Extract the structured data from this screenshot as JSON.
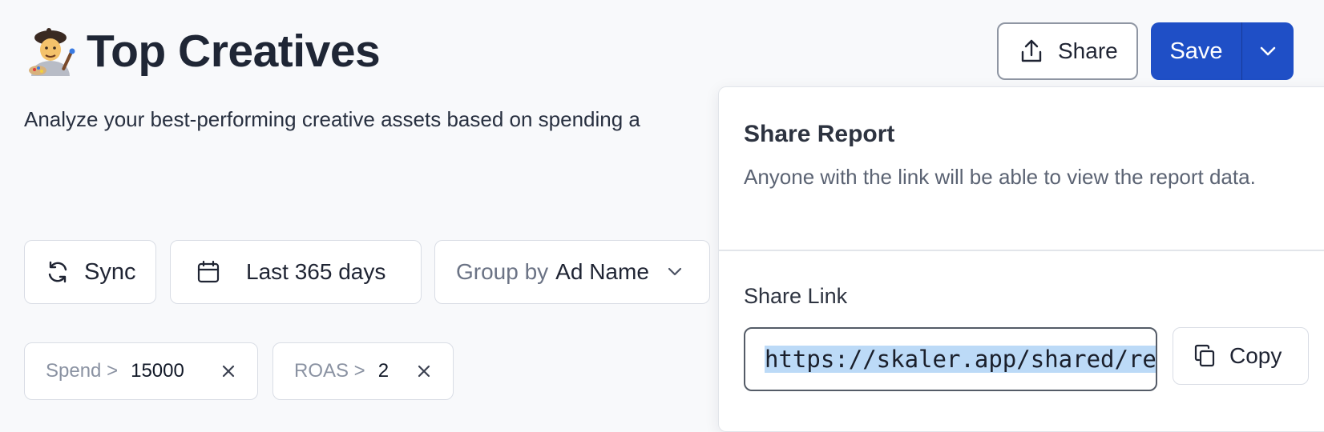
{
  "header": {
    "title": "Top Creatives",
    "emoji_icon": "artist-emoji",
    "subtitle": "Analyze your best-performing creative assets based on spending a"
  },
  "actions": {
    "share_label": "Share",
    "save_label": "Save"
  },
  "toolbar": {
    "sync_label": "Sync",
    "date_range": "Last 365 days",
    "group_prefix": "Group by",
    "group_value": "Ad Name"
  },
  "filters": [
    {
      "label": "Spend >",
      "value": "15000"
    },
    {
      "label": "ROAS >",
      "value": "2"
    }
  ],
  "share_popover": {
    "title": "Share Report",
    "description": "Anyone with the link will be able to view the report data.",
    "link_label": "Share Link",
    "link_value": "https://skaler.app/shared/re",
    "copy_label": "Copy"
  },
  "colors": {
    "primary": "#1f4fc6",
    "background": "#f8f9fb",
    "selection": "#bcdaf7"
  }
}
